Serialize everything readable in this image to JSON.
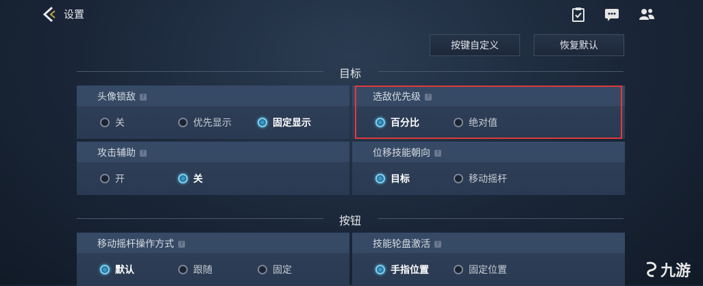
{
  "header": {
    "title": "设置"
  },
  "toolbar": {
    "custom_keys": "按键自定义",
    "restore_default": "恢复默认"
  },
  "sections": {
    "target": "目标",
    "buttons": "按钮"
  },
  "panels": {
    "avatar_lock": {
      "title": "头像锁敌",
      "options": [
        "关",
        "优先显示",
        "固定显示"
      ],
      "selected": 2
    },
    "enemy_priority": {
      "title": "选敌优先级",
      "options": [
        "百分比",
        "绝对值"
      ],
      "selected": 0
    },
    "attack_assist": {
      "title": "攻击辅助",
      "options": [
        "开",
        "关"
      ],
      "selected": 1
    },
    "move_skill_dir": {
      "title": "位移技能朝向",
      "options": [
        "目标",
        "移动摇杆"
      ],
      "selected": 0
    },
    "joystick_mode": {
      "title": "移动摇杆操作方式",
      "options": [
        "默认",
        "跟随",
        "固定"
      ],
      "selected": 0
    },
    "skill_wheel": {
      "title": "技能轮盘激活",
      "options": [
        "手指位置",
        "固定位置"
      ],
      "selected": 0
    }
  },
  "help_glyph": "?",
  "watermark": {
    "text": "九游"
  },
  "colors": {
    "accent": "#5fc7ef",
    "highlight": "#e33a3a"
  }
}
